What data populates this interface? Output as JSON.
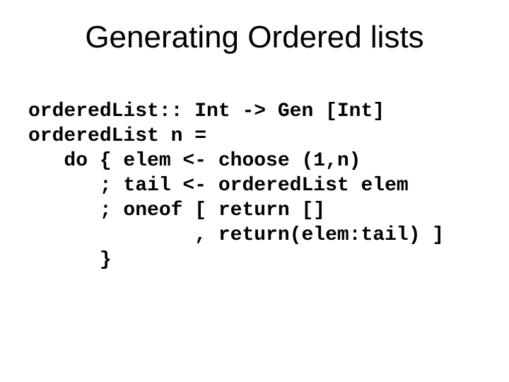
{
  "title": "Generating Ordered lists",
  "code": {
    "l1": "orderedList:: Int -> Gen [Int]",
    "l2": "orderedList n =",
    "l3": "   do { elem <- choose (1,n)",
    "l4": "      ; tail <- orderedList elem",
    "l5": "      ; oneof [ return []",
    "l6": "              , return(elem:tail) ]",
    "l7": "      }"
  }
}
